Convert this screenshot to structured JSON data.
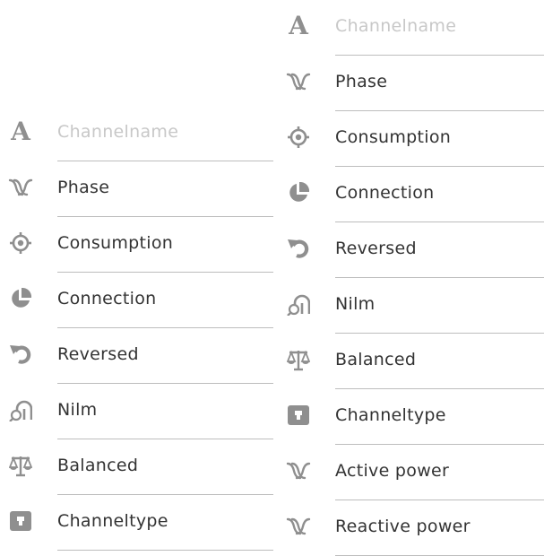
{
  "left_list": {
    "items": [
      {
        "label": "Channelname",
        "icon": "text-letter-a-icon",
        "placeholder": true
      },
      {
        "label": "Phase",
        "icon": "phase-icon"
      },
      {
        "label": "Consumption",
        "icon": "target-icon"
      },
      {
        "label": "Connection",
        "icon": "pie-icon"
      },
      {
        "label": "Reversed",
        "icon": "reverse-arrow-icon"
      },
      {
        "label": "Nilm",
        "icon": "nilm-icon"
      },
      {
        "label": "Balanced",
        "icon": "balance-scale-icon"
      },
      {
        "label": "Channeltype",
        "icon": "channel-type-icon"
      }
    ]
  },
  "right_list": {
    "items": [
      {
        "label": "Channelname",
        "icon": "text-letter-a-icon",
        "placeholder": true
      },
      {
        "label": "Phase",
        "icon": "phase-icon"
      },
      {
        "label": "Consumption",
        "icon": "target-icon"
      },
      {
        "label": "Connection",
        "icon": "pie-icon"
      },
      {
        "label": "Reversed",
        "icon": "reverse-arrow-icon"
      },
      {
        "label": "Nilm",
        "icon": "nilm-icon"
      },
      {
        "label": "Balanced",
        "icon": "balance-scale-icon"
      },
      {
        "label": "Channeltype",
        "icon": "channel-type-icon"
      },
      {
        "label": "Active power",
        "icon": "phase-icon"
      },
      {
        "label": "Reactive power",
        "icon": "phase-icon"
      }
    ]
  },
  "colors": {
    "icon": "#8f8f8f",
    "text": "#333333",
    "placeholder": "#c8c8c8",
    "divider": "#bdbdbd"
  },
  "icon_letter": "A"
}
